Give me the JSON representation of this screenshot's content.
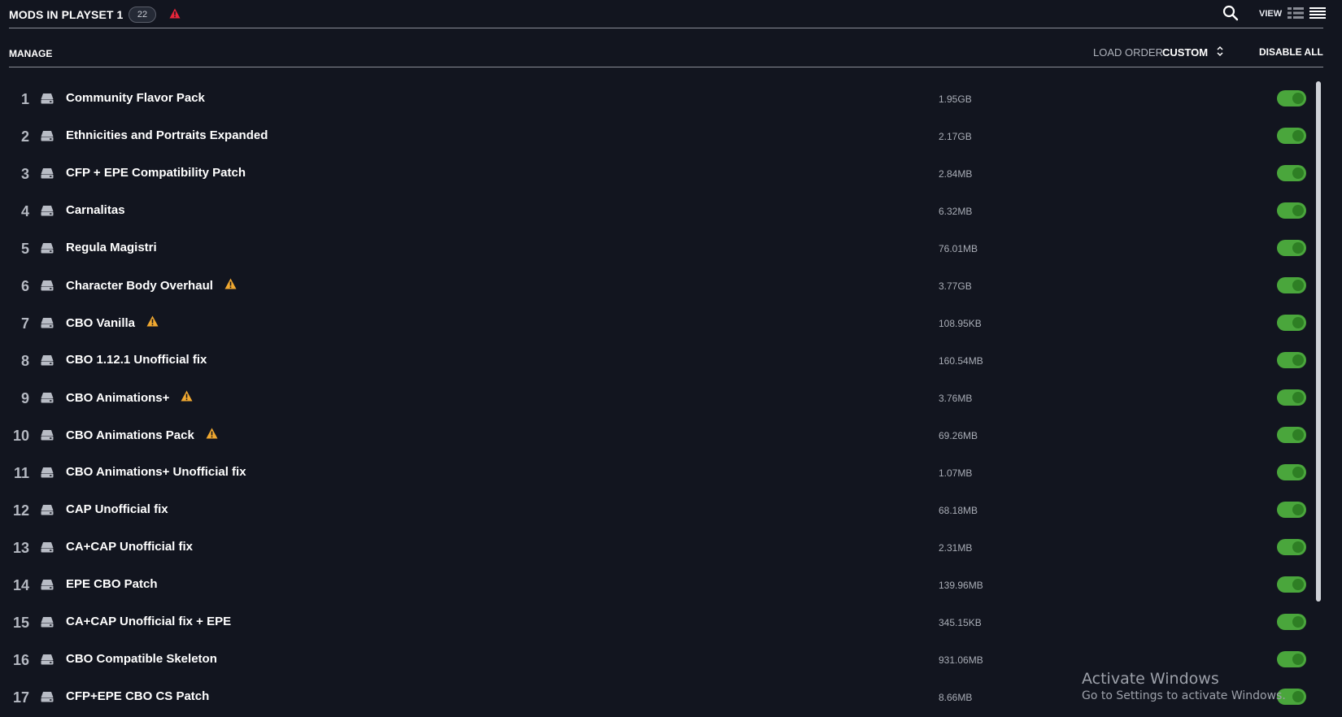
{
  "header": {
    "title": "MODS IN PLAYSET 1",
    "count": "22",
    "view_label": "VIEW"
  },
  "subheader": {
    "manage": "MANAGE",
    "load_order_label": "LOAD ORDER",
    "load_order_value": "CUSTOM",
    "disable_all": "DISABLE ALL"
  },
  "colors": {
    "background": "#12151f",
    "toggle_on": "#4aa63c",
    "warning": "#f0a830",
    "alert": "#e8253a"
  },
  "mods": [
    {
      "index": "1",
      "name": "Community Flavor Pack",
      "size": "1.95GB",
      "warning": false,
      "enabled": true
    },
    {
      "index": "2",
      "name": "Ethnicities and Portraits Expanded",
      "size": "2.17GB",
      "warning": false,
      "enabled": true
    },
    {
      "index": "3",
      "name": "CFP + EPE Compatibility Patch",
      "size": "2.84MB",
      "warning": false,
      "enabled": true
    },
    {
      "index": "4",
      "name": "Carnalitas",
      "size": "6.32MB",
      "warning": false,
      "enabled": true
    },
    {
      "index": "5",
      "name": "Regula Magistri",
      "size": "76.01MB",
      "warning": false,
      "enabled": true
    },
    {
      "index": "6",
      "name": "Character Body Overhaul",
      "size": "3.77GB",
      "warning": true,
      "enabled": true
    },
    {
      "index": "7",
      "name": "CBO Vanilla",
      "size": "108.95KB",
      "warning": true,
      "enabled": true
    },
    {
      "index": "8",
      "name": "CBO 1.12.1 Unofficial fix",
      "size": "160.54MB",
      "warning": false,
      "enabled": true
    },
    {
      "index": "9",
      "name": "CBO Animations+",
      "size": "3.76MB",
      "warning": true,
      "enabled": true
    },
    {
      "index": "10",
      "name": "CBO Animations Pack",
      "size": "69.26MB",
      "warning": true,
      "enabled": true
    },
    {
      "index": "11",
      "name": "CBO Animations+ Unofficial fix",
      "size": "1.07MB",
      "warning": false,
      "enabled": true
    },
    {
      "index": "12",
      "name": "CAP Unofficial fix",
      "size": "68.18MB",
      "warning": false,
      "enabled": true
    },
    {
      "index": "13",
      "name": "CA+CAP Unofficial fix",
      "size": "2.31MB",
      "warning": false,
      "enabled": true
    },
    {
      "index": "14",
      "name": "EPE CBO Patch",
      "size": "139.96MB",
      "warning": false,
      "enabled": true
    },
    {
      "index": "15",
      "name": "CA+CAP Unofficial fix + EPE",
      "size": "345.15KB",
      "warning": false,
      "enabled": true
    },
    {
      "index": "16",
      "name": "CBO Compatible Skeleton",
      "size": "931.06MB",
      "warning": false,
      "enabled": true
    },
    {
      "index": "17",
      "name": "CFP+EPE CBO CS Patch",
      "size": "8.66MB",
      "warning": false,
      "enabled": true
    }
  ],
  "overlay": {
    "activate_title": "Activate Windows",
    "activate_sub": "Go to Settings to activate Windows."
  }
}
